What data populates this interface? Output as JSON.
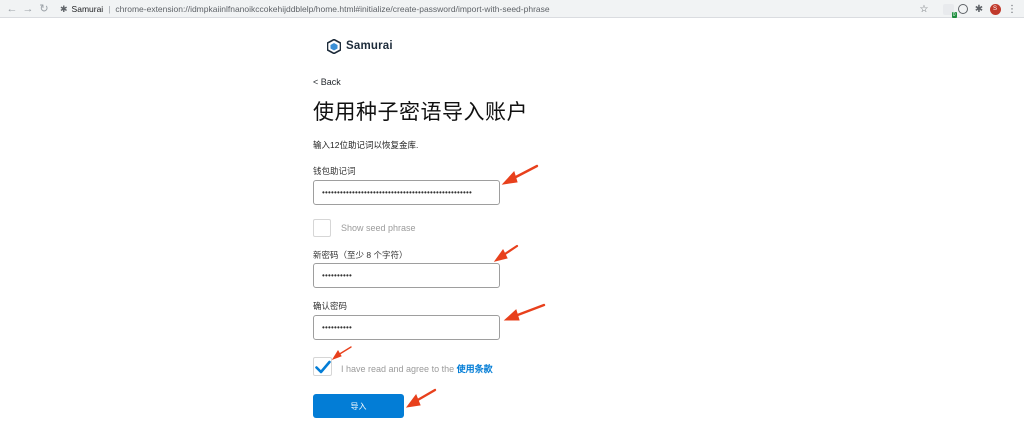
{
  "browser": {
    "tab_site": "Samurai",
    "url": "chrome-extension://idmpkaiinlfnanoikccokehijddblelp/home.html#initialize/create-password/import-with-seed-phrase",
    "extension_badge": "0",
    "avatar_initial": "S"
  },
  "app": {
    "brand": "Samurai",
    "back_label": "< Back",
    "title": "使用种子密语导入账户",
    "subtitle": "输入12位助记词以恢复金库."
  },
  "form": {
    "seed_label": "钱包助记词",
    "seed_value": "••••••••••••••••••••••••••••••••••••••••••••••••••",
    "show_seed_label": "Show seed phrase",
    "new_password_label": "新密码（至少 8 个字符）",
    "new_password_value": "••••••••••",
    "confirm_password_label": "确认密码",
    "confirm_password_value": "••••••••••",
    "terms_text": "I have read and agree to the ",
    "terms_link": "使用条款",
    "terms_checked": true,
    "show_seed_checked": false,
    "import_button": "导入"
  },
  "colors": {
    "accent": "#037dd6",
    "annotation_arrow": "#e8401c"
  }
}
